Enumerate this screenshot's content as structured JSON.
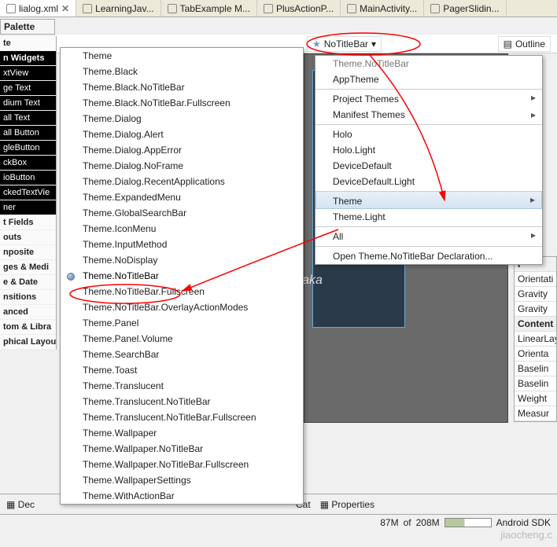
{
  "tabs": [
    {
      "label": "lialog.xml",
      "active": true,
      "close": true
    },
    {
      "label": "LearningJav...",
      "active": false
    },
    {
      "label": "TabExample M...",
      "active": false
    },
    {
      "label": "PlusActionP...",
      "active": false
    },
    {
      "label": "MainActivity...",
      "active": false
    },
    {
      "label": "PagerSlidin...",
      "active": false
    }
  ],
  "palette_title": "Palette",
  "palette": [
    {
      "label": "te",
      "cat": true
    },
    {
      "label": "n Widgets",
      "cat": true,
      "sel": true
    },
    {
      "label": "xtView",
      "sel": true
    },
    {
      "label": "ge Text",
      "sel": true
    },
    {
      "label": "dium Text",
      "sel": true
    },
    {
      "label": "all Text",
      "sel": true
    },
    {
      "label": "all Button",
      "sel": true
    },
    {
      "label": "gleButton",
      "sel": true
    },
    {
      "label": "ckBox",
      "sel": true
    },
    {
      "label": "ioButton",
      "sel": true
    },
    {
      "label": "ckedTextVie",
      "sel": true
    },
    {
      "label": "ner",
      "sel": true
    },
    {
      "label": "t Fields",
      "cat": true
    },
    {
      "label": "outs",
      "cat": true
    },
    {
      "label": "nposite",
      "cat": true
    },
    {
      "label": "ges & Medi",
      "cat": true
    },
    {
      "label": "e & Date",
      "cat": true
    },
    {
      "label": "nsitions",
      "cat": true
    },
    {
      "label": "anced",
      "cat": true
    },
    {
      "label": "tom & Libra",
      "cat": true
    },
    {
      "label": "phical Layout",
      "cat": true
    }
  ],
  "theme_button": "NoTitleBar",
  "outline_label": "Outline",
  "menu1": [
    "Theme",
    "Theme.Black",
    "Theme.Black.NoTitleBar",
    "Theme.Black.NoTitleBar.Fullscreen",
    "Theme.Dialog",
    "Theme.Dialog.Alert",
    "Theme.Dialog.AppError",
    "Theme.Dialog.NoFrame",
    "Theme.Dialog.RecentApplications",
    "Theme.ExpandedMenu",
    "Theme.GlobalSearchBar",
    "Theme.IconMenu",
    "Theme.InputMethod",
    "Theme.NoDisplay",
    "Theme.NoTitleBar",
    "Theme.NoTitleBar.Fullscreen",
    "Theme.NoTitleBar.OverlayActionModes",
    "Theme.Panel",
    "Theme.Panel.Volume",
    "Theme.SearchBar",
    "Theme.Toast",
    "Theme.Translucent",
    "Theme.Translucent.NoTitleBar",
    "Theme.Translucent.NoTitleBar.Fullscreen",
    "Theme.Wallpaper",
    "Theme.Wallpaper.NoTitleBar",
    "Theme.Wallpaper.NoTitleBar.Fullscreen",
    "Theme.WallpaperSettings",
    "Theme.WithActionBar"
  ],
  "menu1_selected_index": 14,
  "menu2": [
    {
      "label": "Theme.NoTitleBar",
      "head": true
    },
    {
      "label": "AppTheme"
    },
    {
      "label": "Project Themes",
      "sub": true,
      "sep": true
    },
    {
      "label": "Manifest Themes",
      "sub": true
    },
    {
      "label": "Holo",
      "sep": true
    },
    {
      "label": "Holo.Light"
    },
    {
      "label": "DeviceDefault"
    },
    {
      "label": "DeviceDefault.Light"
    },
    {
      "label": "Theme",
      "sub": true,
      "sel": true,
      "sep": true
    },
    {
      "label": "Theme.Light"
    },
    {
      "label": "All",
      "sub": true,
      "sep": true
    },
    {
      "label": "Open Theme.NoTitleBar Declaration...",
      "sep": true
    }
  ],
  "props": {
    "p_label": "P",
    "orientation": "Orientati",
    "gravity1": "Gravity",
    "gravity2": "Gravity",
    "content": "Content I",
    "linear": "LinearLay",
    "orient2": "Orienta",
    "baseline1": "Baselin",
    "baseline2": "Baselin",
    "weight": "Weight",
    "measure": "Measur"
  },
  "footer": {
    "dec": "Dec",
    "cat": "Cat",
    "properties": "Properties"
  },
  "status": {
    "mem_used": "87M",
    "mem_of": "of",
    "mem_total": "208M",
    "sdk": "Android SDK"
  },
  "watermark": "http://blog.csdn.net/Evankaka",
  "watermark2": "jiaocheng.c"
}
